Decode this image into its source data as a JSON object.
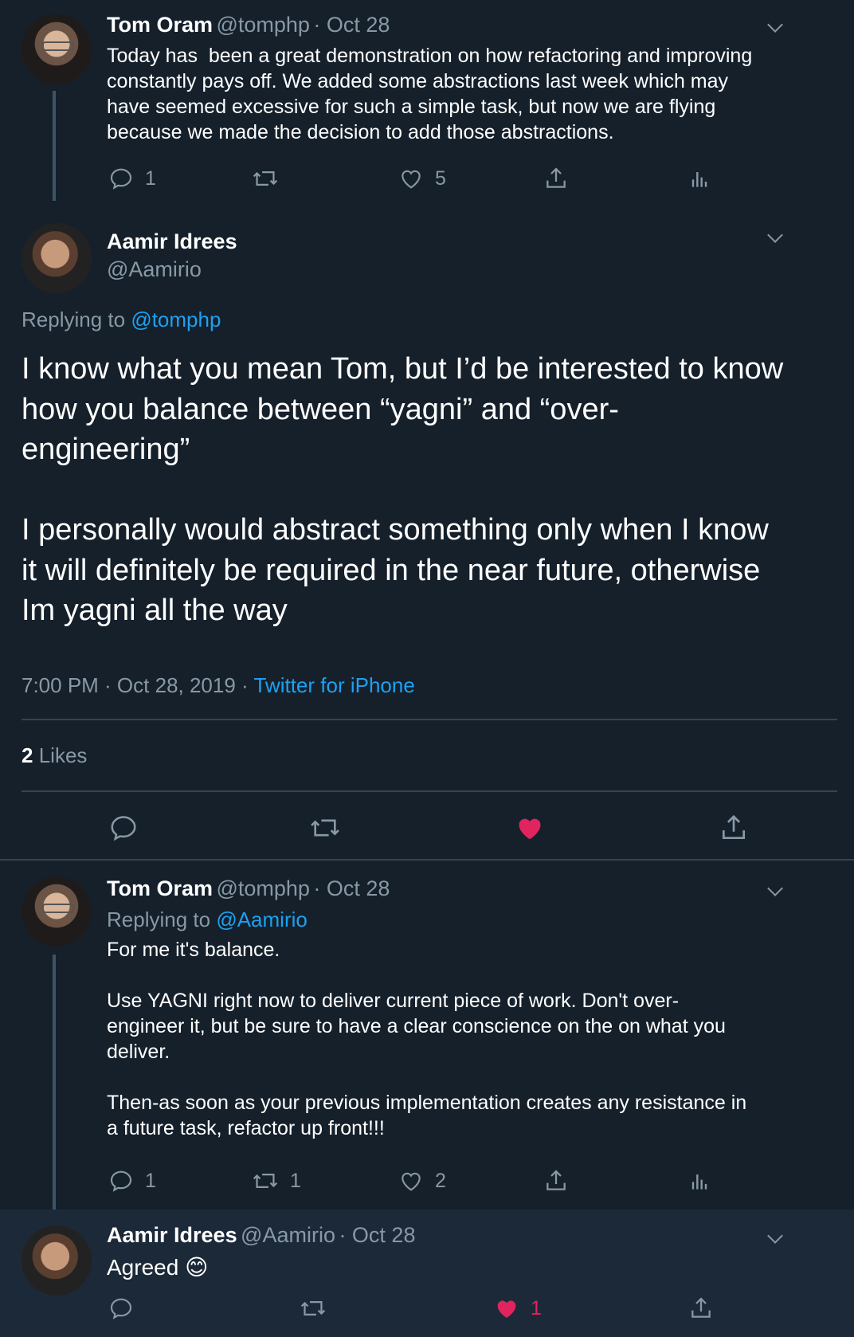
{
  "tweet1": {
    "name": "Tom Oram",
    "handle": "@tomphp",
    "date": "· Oct 28",
    "text": "Today has  been a great demonstration on how refactoring and improving\nconstantly pays off. We added some abstractions last week which may\nhave seemed excessive for such a simple task, but now we are flying\nbecause we made the decision to add those abstractions.",
    "replies": "1",
    "retweets": "",
    "likes": "5"
  },
  "main": {
    "name": "Aamir Idrees",
    "handle": "@Aamirio",
    "replying_label": "Replying to",
    "replying_to": "@tomphp",
    "text": "I know what you mean Tom, but I’d be interested to know\nhow you balance between “yagni” and “over-\nengineering”\n\nI personally would abstract something only when I know\nit will definitely be required in the near future, otherwise\nIm yagni all the way",
    "timestamp": "7:00 PM · Oct 28, 2019 ·",
    "source": "Twitter for iPhone",
    "likes_count": "2",
    "likes_label": "Likes"
  },
  "tweet3": {
    "name": "Tom Oram",
    "handle": "@tomphp",
    "date": "· Oct 28",
    "replying_label": "Replying to",
    "replying_to": "@Aamirio",
    "text": "For me it's balance.\n\nUse YAGNI right now to deliver current piece of work. Don't over-\nengineer it, but be sure to have a clear conscience on the on what you\ndeliver.\n\nThen-as soon as your previous implementation creates any resistance in\na future task, refactor up front!!!",
    "replies": "1",
    "retweets": "1",
    "likes": "2"
  },
  "tweet4": {
    "name": "Aamir Idrees",
    "handle": "@Aamirio",
    "date": "· Oct 28",
    "text": "Agreed",
    "emoji": "😊",
    "likes": "1"
  },
  "colors": {
    "background": "#15202b",
    "muted": "#8899a6",
    "link": "#1da1f2",
    "like_red": "#e0245e",
    "thread_line": "#3d5466"
  }
}
